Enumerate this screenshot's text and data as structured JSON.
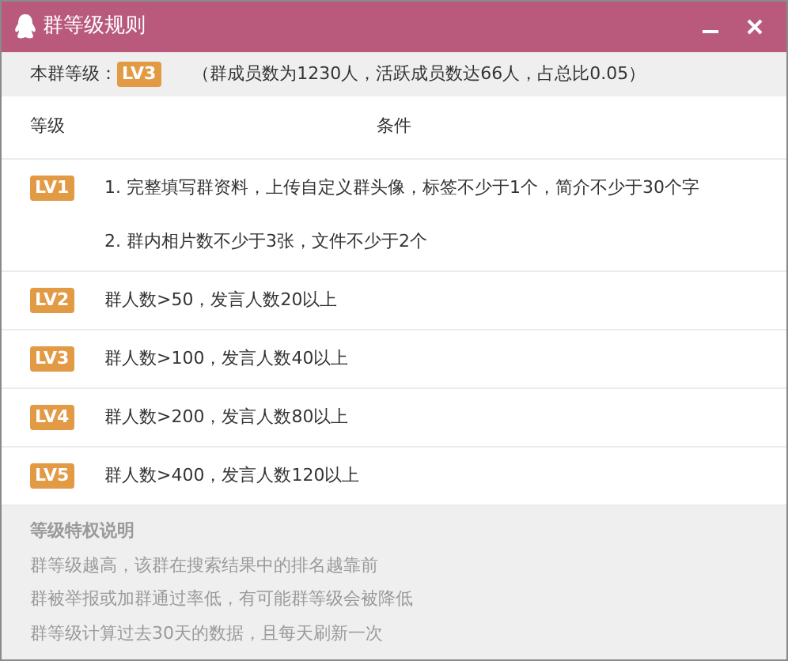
{
  "window": {
    "title": "群等级规则"
  },
  "summary": {
    "label": "本群等级：",
    "level_badge": "LV3",
    "detail": "（群成员数为1230人，活跃成员数达66人，占总比0.05）"
  },
  "table": {
    "columns": [
      "等级",
      "条件"
    ],
    "rows": [
      {
        "level": "LV1",
        "conditions": [
          "1. 完整填写群资料，上传自定义群头像，标签不少于1个，简介不少于30个字",
          "2. 群内相片数不少于3张，文件不少于2个"
        ]
      },
      {
        "level": "LV2",
        "conditions": [
          "群人数>50，发言人数20以上"
        ]
      },
      {
        "level": "LV3",
        "conditions": [
          "群人数>100，发言人数40以上"
        ]
      },
      {
        "level": "LV4",
        "conditions": [
          "群人数>200，发言人数80以上"
        ]
      },
      {
        "level": "LV5",
        "conditions": [
          "群人数>400，发言人数120以上"
        ]
      }
    ]
  },
  "notes": {
    "title": "等级特权说明",
    "lines": [
      "群等级越高，该群在搜索结果中的排名越靠前",
      "群被举报或加群通过率低，有可能群等级会被降低",
      "群等级计算过去30天的数据，且每天刷新一次"
    ]
  }
}
